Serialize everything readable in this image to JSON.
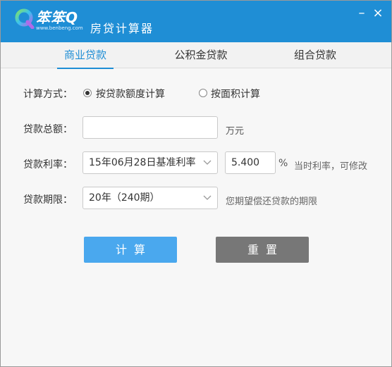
{
  "window": {
    "logo_text": "笨笨Q",
    "logo_url": "www.benbeng.com",
    "title": "房贷计算器",
    "minimize_glyph": "–",
    "close_glyph": "×"
  },
  "tabs": [
    {
      "label": "商业贷款",
      "active": true
    },
    {
      "label": "公积金贷款",
      "active": false
    },
    {
      "label": "组合贷款",
      "active": false
    }
  ],
  "form": {
    "calc_method": {
      "label": "计算方式：",
      "options": [
        {
          "label": "按贷款额度计算",
          "selected": true
        },
        {
          "label": "按面积计算",
          "selected": false
        }
      ]
    },
    "loan_total": {
      "label": "贷款总额：",
      "value": "",
      "unit": "万元"
    },
    "interest_rate": {
      "label": "贷款利率：",
      "select_value": "15年06月28日基准利率",
      "rate_value": "5.400",
      "unit": "%",
      "hint": "当时利率，可修改"
    },
    "loan_term": {
      "label": "贷款期限：",
      "select_value": "20年（240期）",
      "hint": "您期望偿还贷款的期限"
    }
  },
  "buttons": {
    "calculate": "计算",
    "reset": "重置"
  },
  "colors": {
    "titlebar": "#1f8ed5",
    "active_tab": "#1f8ed5",
    "calc_button": "#4aa8ee",
    "reset_button": "#777777"
  }
}
